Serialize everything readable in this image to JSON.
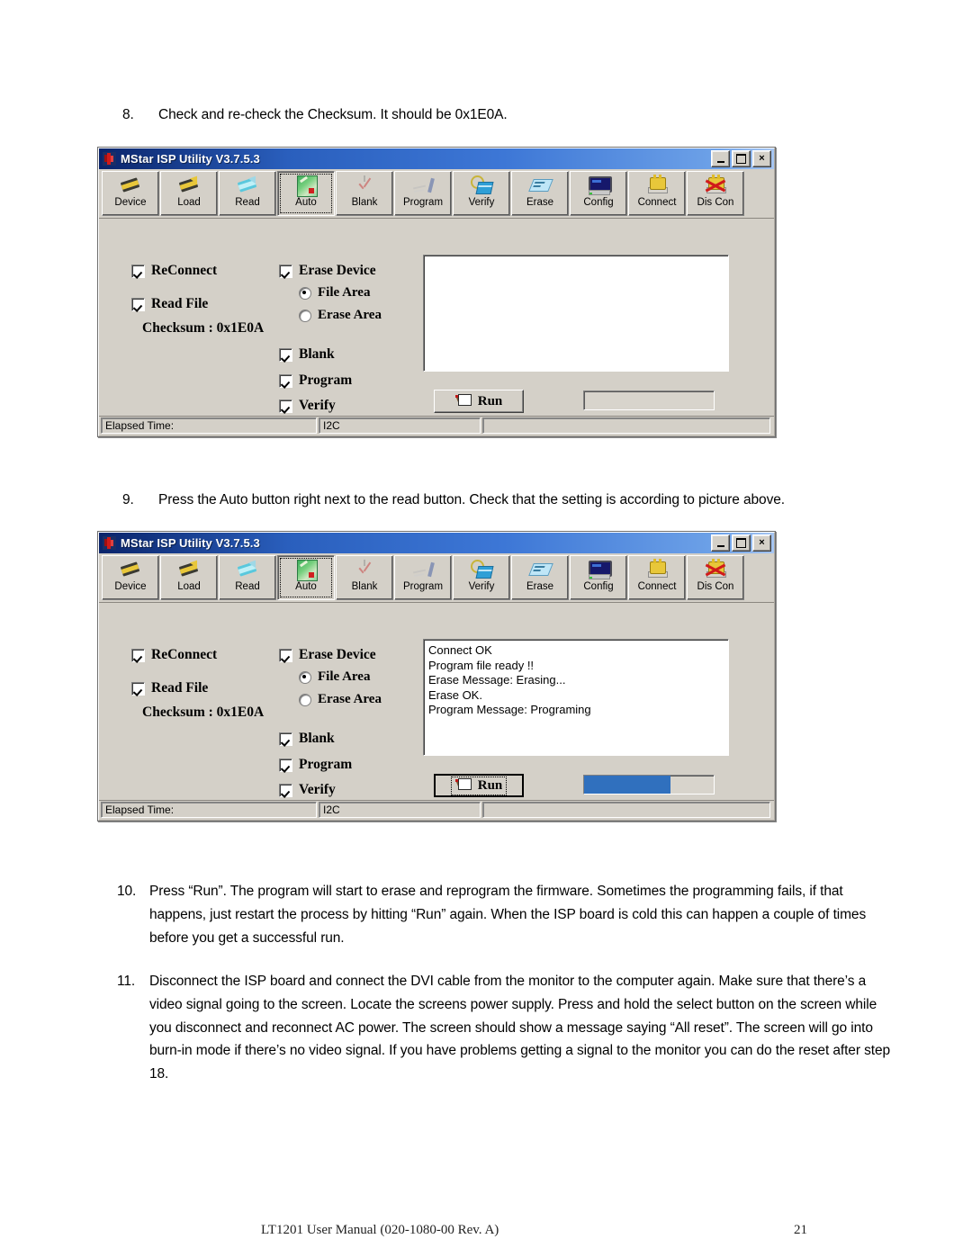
{
  "document": {
    "steps": [
      {
        "num": "8.",
        "text": "Check and re-check the Checksum. It should be 0x1E0A."
      },
      {
        "num": "9.",
        "text": "Press the Auto button right next to the read button. Check that the setting is according to picture above."
      },
      {
        "num": "10.",
        "text": "Press “Run”. The program will start to erase and reprogram the firmware. Sometimes the programming fails, if that happens, just restart the process by hitting “Run” again. When the ISP board is cold this can happen a couple of times before you get a successful run."
      },
      {
        "num": "11.",
        "text": "Disconnect the ISP board and connect the DVI cable from the monitor to the computer again. Make sure that there’s a video signal going to the screen. Locate the screens power supply. Press and hold the select button on the screen while you disconnect and reconnect AC power.    The screen should show a message saying “All reset”. The screen will go into burn-in mode if there’s no video signal. If you have problems getting a signal to the monitor you can do the reset after step 18."
      }
    ],
    "footer": {
      "center": "LT1201 User Manual (020-1080-00 Rev. A)",
      "page": "21"
    }
  },
  "window": {
    "title": "MStar ISP Utility V3.7.5.3",
    "controls": {
      "minimize": "minimize-button",
      "maximize": "maximize-button",
      "close": "×"
    },
    "toolbar": [
      {
        "label": "Device",
        "icon": "chip-icon",
        "state": "normal",
        "selected": false
      },
      {
        "label": "Load",
        "icon": "chip-load-icon",
        "state": "normal",
        "selected": false
      },
      {
        "label": "Read",
        "icon": "chip-read-icon",
        "state": "normal",
        "selected": false
      },
      {
        "label": "Auto",
        "icon": "auto-icon",
        "state": "normal",
        "selected": true
      },
      {
        "label": "Blank",
        "icon": "checkmark-icon",
        "state": "dim",
        "selected": false
      },
      {
        "label": "Program",
        "icon": "pencil-icon",
        "state": "dim",
        "selected": false
      },
      {
        "label": "Verify",
        "icon": "magnifier-book-icon",
        "state": "normal",
        "selected": false
      },
      {
        "label": "Erase",
        "icon": "eraser-icon",
        "state": "normal",
        "selected": false
      },
      {
        "label": "Config",
        "icon": "monitor-icon",
        "state": "normal",
        "selected": false
      },
      {
        "label": "Connect",
        "icon": "plug-icon",
        "state": "normal",
        "selected": false
      },
      {
        "label": "Dis Con",
        "icon": "plug-disconnect-icon",
        "state": "normal",
        "selected": false
      }
    ],
    "options": {
      "reconnect": {
        "label": "ReConnect",
        "checked": true
      },
      "read_file": {
        "label": "Read File",
        "checked": true
      },
      "checksum": {
        "label": "Checksum : 0x1E0A",
        "value": "0x1E0A"
      },
      "erase_device": {
        "label": "Erase Device",
        "checked": true
      },
      "file_area": {
        "label": "File Area",
        "selected": true
      },
      "erase_area": {
        "label": "Erase Area",
        "selected": false
      },
      "blank": {
        "label": "Blank",
        "checked": true
      },
      "program": {
        "label": "Program",
        "checked": true
      },
      "verify": {
        "label": "Verify",
        "checked": true
      }
    },
    "run_button": {
      "label": "Run",
      "icon": "run-icon"
    },
    "status": {
      "elapsed_label": "Elapsed Time:",
      "protocol": "I2C",
      "message": ""
    }
  },
  "dialog_one": {
    "log_lines": [],
    "progress_percent": 0,
    "run_focused": false
  },
  "dialog_two": {
    "log_lines": [
      "Connect OK",
      "Program file ready !!",
      "Erase Message: Erasing...",
      "Erase OK.",
      "Program Message: Programing"
    ],
    "progress_percent": 67,
    "run_focused": true
  },
  "colors": {
    "progress_fill": "#3070be",
    "window_face": "#d4d0c8",
    "titlebar_start": "#0a246a",
    "titlebar_end": "#a7c6f2"
  }
}
